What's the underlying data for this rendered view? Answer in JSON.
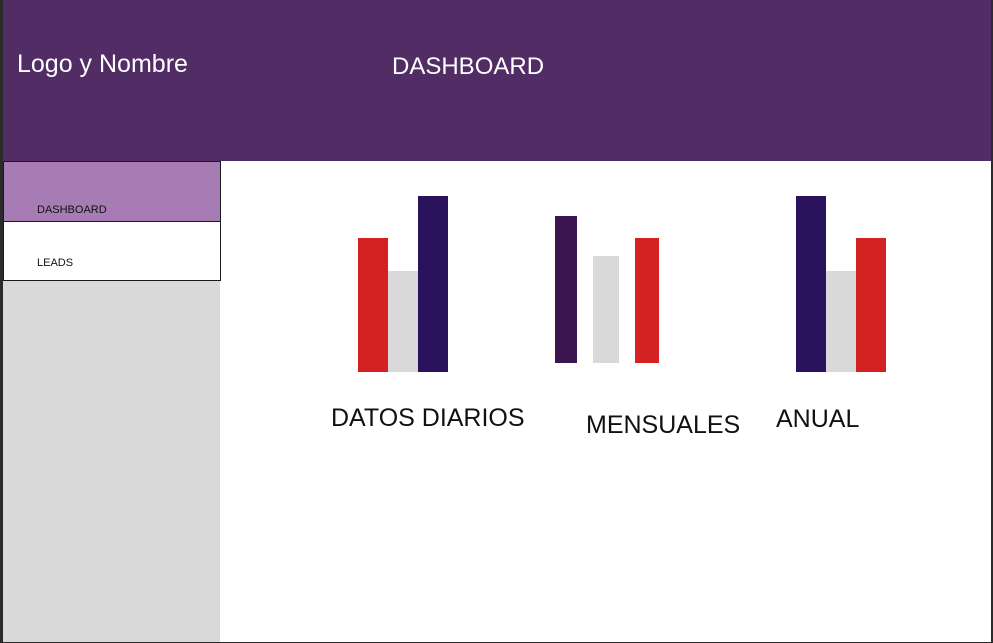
{
  "header": {
    "logo_text": "Logo y Nombre",
    "title": "DASHBOARD",
    "background_color": "#512c65"
  },
  "sidebar": {
    "background_color": "#d9d9d9",
    "items": [
      {
        "label": "DASHBOARD",
        "active": true,
        "color": "#a77cb4"
      },
      {
        "label": "LEADS",
        "active": false,
        "color": "#ffffff"
      }
    ]
  },
  "colors": {
    "red": "#d42222",
    "gray": "#d9d9d9",
    "navy": "#2a135c",
    "purple": "#3a1550"
  },
  "chart_data": [
    {
      "type": "bar",
      "title": "DATOS DIARIOS",
      "values": [
        134,
        101,
        176
      ],
      "colors": [
        "#d42222",
        "#d9d9d9",
        "#2a135c"
      ]
    },
    {
      "type": "bar",
      "title": "MENSUALES",
      "values": [
        147,
        107,
        125
      ],
      "colors": [
        "#3a1550",
        "#d9d9d9",
        "#d42222"
      ]
    },
    {
      "type": "bar",
      "title": "ANUAL",
      "values": [
        176,
        101,
        134
      ],
      "colors": [
        "#2a135c",
        "#d9d9d9",
        "#d42222"
      ]
    }
  ]
}
